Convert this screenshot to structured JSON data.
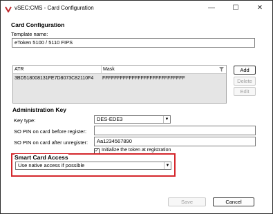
{
  "window": {
    "title": "vSEC:CMS - Card Configuration",
    "minimize_glyph": "—",
    "maximize_glyph": "☐",
    "close_glyph": "✕"
  },
  "card_config": {
    "heading": "Card Configuration",
    "template_label": "Template name:",
    "template_value": "eToken 5100 / 5110 FIPS"
  },
  "table": {
    "columns": [
      "ATR",
      "Mask"
    ],
    "rows": [
      {
        "atr": "3BD518008131FE7D8073C82110F4",
        "mask": "FFFFFFFFFFFFFFFFFFFFFFFFFFFF"
      }
    ],
    "add_label": "Add",
    "delete_label": "Delete",
    "edit_label": "Edit"
  },
  "admin_key": {
    "heading": "Administration Key",
    "key_type_label": "Key type:",
    "key_type_value": "DES-EDE3",
    "so_pin_before_label": "SO PIN on card before register:",
    "so_pin_before_value": "",
    "so_pin_after_label": "SO PIN on card after unregister:",
    "so_pin_after_value": "Aa1234567890",
    "initialize_label": "Initialize the token at registration",
    "initialize_checked": "✓"
  },
  "smart_card_access": {
    "heading": "Smart Card Access",
    "value": "Use native access if possible"
  },
  "footer": {
    "save_label": "Save",
    "cancel_label": "Cancel"
  },
  "colors": {
    "highlight": "#d4262b",
    "title_icon": "#c0282d"
  }
}
